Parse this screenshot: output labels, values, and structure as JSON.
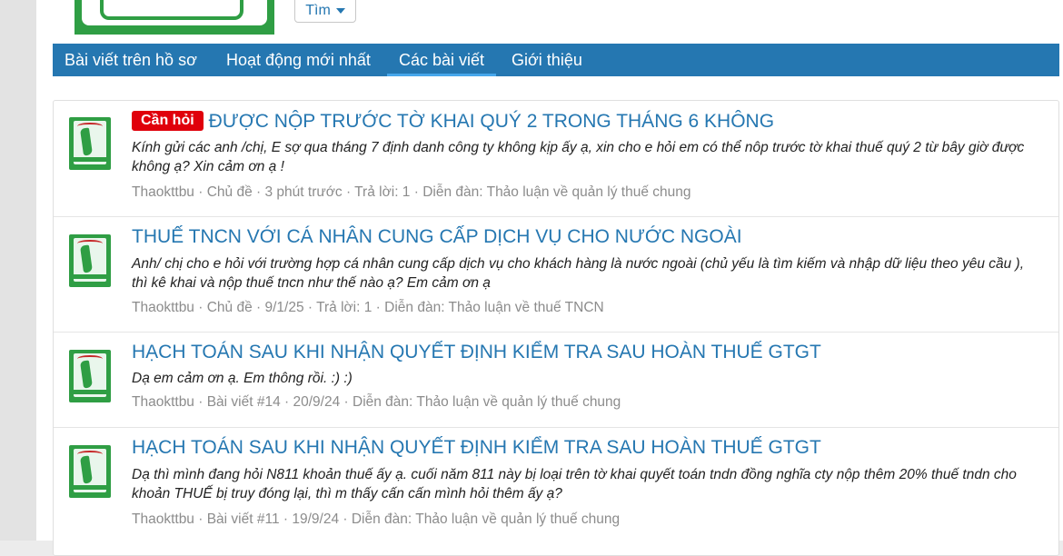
{
  "header": {
    "find_button_label": "Tìm"
  },
  "tabs": [
    {
      "label": "Bài viết trên hồ sơ"
    },
    {
      "label": "Hoạt động mới nhất"
    },
    {
      "label": "Các bài viết"
    },
    {
      "label": "Giới thiệu"
    }
  ],
  "active_tab": "Các bài viết",
  "posts": [
    {
      "badge": "Cần hỏi",
      "title": "ĐƯỢC NỘP TRƯỚC TỜ KHAI QUÝ 2 TRONG THÁNG 6 KHÔNG",
      "snippet": "Kính gửi các anh /chị, E sợ qua tháng 7 định danh công ty không kịp ấy ạ, xin cho e hỏi em có thể nôp trước tờ khai thuế quý 2 từ bây giờ được không ạ? Xin cảm ơn ạ !",
      "author": "Thaokttbu",
      "type": "Chủ đề",
      "time": "3 phút trước",
      "replies": "Trả lời: 1",
      "forum": "Diễn đàn: Thảo luận về quản lý thuế chung"
    },
    {
      "badge": "",
      "title": "THUẾ TNCN VỚI CÁ NHÂN CUNG CẤP DỊCH VỤ CHO NƯỚC NGOÀI",
      "snippet": "Anh/ chị cho e hỏi với trường hợp cá nhân cung cấp dịch vụ cho khách hàng là nước ngoài (chủ yếu là tìm kiếm và nhập dữ liệu theo yêu cầu ), thì kê khai và nộp thuế tncn như thế nào ạ? Em cảm ơn ạ",
      "author": "Thaokttbu",
      "type": "Chủ đề",
      "time": "9/1/25",
      "replies": "Trả lời: 1",
      "forum": "Diễn đàn: Thảo luận về thuế TNCN"
    },
    {
      "badge": "",
      "title": "HẠCH TOÁN SAU KHI NHẬN QUYẾT ĐỊNH KIỂM TRA SAU HOÀN THUẾ GTGT",
      "snippet": "Dạ em cảm ơn ạ. Em thông rồi. :) :)",
      "author": "Thaokttbu",
      "type": "Bài viết #14",
      "time": "20/9/24",
      "replies": "",
      "forum": "Diễn đàn: Thảo luận về quản lý thuế chung"
    },
    {
      "badge": "",
      "title": "HẠCH TOÁN SAU KHI NHẬN QUYẾT ĐỊNH KIỂM TRA SAU HOÀN THUẾ GTGT",
      "snippet": "Dạ thì mình đang hỏi N811 khoản thuế ấy ạ. cuối năm 811 này bị loại trên tờ khai quyết toán tndn đồng nghĩa cty nộp thêm 20% thuế tndn cho khoản THUẾ bị truy đóng lại, thì m thấy cấn cấn mình hỏi thêm ấy ạ?",
      "author": "Thaokttbu",
      "type": "Bài viết #11",
      "time": "19/9/24",
      "replies": "",
      "forum": "Diễn đàn: Thảo luận về quản lý thuế chung"
    }
  ],
  "colors": {
    "brand_blue": "#2577b1",
    "badge_red": "#e0000b",
    "avatar_green": "#2f9e44"
  }
}
